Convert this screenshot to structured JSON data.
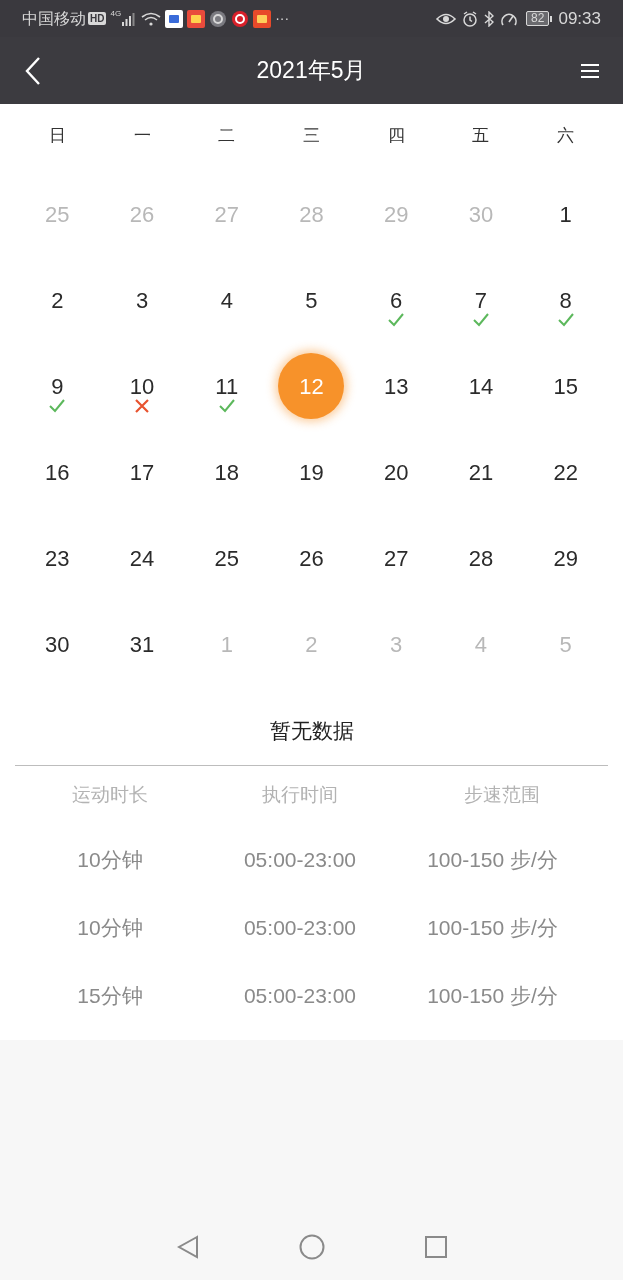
{
  "status_bar": {
    "carrier": "中国移动",
    "hd": "HD",
    "network": "4G",
    "more": "···",
    "battery": "82",
    "time": "09:33"
  },
  "header": {
    "title": "2021年5月"
  },
  "weekdays": [
    "日",
    "一",
    "二",
    "三",
    "四",
    "五",
    "六"
  ],
  "days": [
    {
      "day": "25",
      "in_month": false,
      "selected": false,
      "done": false,
      "missed": false
    },
    {
      "day": "26",
      "in_month": false,
      "selected": false,
      "done": false,
      "missed": false
    },
    {
      "day": "27",
      "in_month": false,
      "selected": false,
      "done": false,
      "missed": false
    },
    {
      "day": "28",
      "in_month": false,
      "selected": false,
      "done": false,
      "missed": false
    },
    {
      "day": "29",
      "in_month": false,
      "selected": false,
      "done": false,
      "missed": false
    },
    {
      "day": "30",
      "in_month": false,
      "selected": false,
      "done": false,
      "missed": false
    },
    {
      "day": "1",
      "in_month": true,
      "selected": false,
      "done": false,
      "missed": false
    },
    {
      "day": "2",
      "in_month": true,
      "selected": false,
      "done": false,
      "missed": false
    },
    {
      "day": "3",
      "in_month": true,
      "selected": false,
      "done": false,
      "missed": false
    },
    {
      "day": "4",
      "in_month": true,
      "selected": false,
      "done": false,
      "missed": false
    },
    {
      "day": "5",
      "in_month": true,
      "selected": false,
      "done": false,
      "missed": false
    },
    {
      "day": "6",
      "in_month": true,
      "selected": false,
      "done": true,
      "missed": false
    },
    {
      "day": "7",
      "in_month": true,
      "selected": false,
      "done": true,
      "missed": false
    },
    {
      "day": "8",
      "in_month": true,
      "selected": false,
      "done": true,
      "missed": false
    },
    {
      "day": "9",
      "in_month": true,
      "selected": false,
      "done": true,
      "missed": false
    },
    {
      "day": "10",
      "in_month": true,
      "selected": false,
      "done": false,
      "missed": true
    },
    {
      "day": "11",
      "in_month": true,
      "selected": false,
      "done": true,
      "missed": false
    },
    {
      "day": "12",
      "in_month": true,
      "selected": true,
      "done": false,
      "missed": false
    },
    {
      "day": "13",
      "in_month": true,
      "selected": false,
      "done": false,
      "missed": false
    },
    {
      "day": "14",
      "in_month": true,
      "selected": false,
      "done": false,
      "missed": false
    },
    {
      "day": "15",
      "in_month": true,
      "selected": false,
      "done": false,
      "missed": false
    },
    {
      "day": "16",
      "in_month": true,
      "selected": false,
      "done": false,
      "missed": false
    },
    {
      "day": "17",
      "in_month": true,
      "selected": false,
      "done": false,
      "missed": false
    },
    {
      "day": "18",
      "in_month": true,
      "selected": false,
      "done": false,
      "missed": false
    },
    {
      "day": "19",
      "in_month": true,
      "selected": false,
      "done": false,
      "missed": false
    },
    {
      "day": "20",
      "in_month": true,
      "selected": false,
      "done": false,
      "missed": false
    },
    {
      "day": "21",
      "in_month": true,
      "selected": false,
      "done": false,
      "missed": false
    },
    {
      "day": "22",
      "in_month": true,
      "selected": false,
      "done": false,
      "missed": false
    },
    {
      "day": "23",
      "in_month": true,
      "selected": false,
      "done": false,
      "missed": false
    },
    {
      "day": "24",
      "in_month": true,
      "selected": false,
      "done": false,
      "missed": false
    },
    {
      "day": "25",
      "in_month": true,
      "selected": false,
      "done": false,
      "missed": false
    },
    {
      "day": "26",
      "in_month": true,
      "selected": false,
      "done": false,
      "missed": false
    },
    {
      "day": "27",
      "in_month": true,
      "selected": false,
      "done": false,
      "missed": false
    },
    {
      "day": "28",
      "in_month": true,
      "selected": false,
      "done": false,
      "missed": false
    },
    {
      "day": "29",
      "in_month": true,
      "selected": false,
      "done": false,
      "missed": false
    },
    {
      "day": "30",
      "in_month": true,
      "selected": false,
      "done": false,
      "missed": false
    },
    {
      "day": "31",
      "in_month": true,
      "selected": false,
      "done": false,
      "missed": false
    },
    {
      "day": "1",
      "in_month": false,
      "selected": false,
      "done": false,
      "missed": false
    },
    {
      "day": "2",
      "in_month": false,
      "selected": false,
      "done": false,
      "missed": false
    },
    {
      "day": "3",
      "in_month": false,
      "selected": false,
      "done": false,
      "missed": false
    },
    {
      "day": "4",
      "in_month": false,
      "selected": false,
      "done": false,
      "missed": false
    },
    {
      "day": "5",
      "in_month": false,
      "selected": false,
      "done": false,
      "missed": false
    }
  ],
  "empty_message": "暂无数据",
  "table": {
    "columns": [
      "运动时长",
      "执行时间",
      "步速范围"
    ],
    "rows": [
      [
        "10分钟",
        "05:00-23:00",
        "100-150 步/分"
      ],
      [
        "10分钟",
        "05:00-23:00",
        "100-150 步/分"
      ],
      [
        "15分钟",
        "05:00-23:00",
        "100-150 步/分"
      ]
    ]
  }
}
